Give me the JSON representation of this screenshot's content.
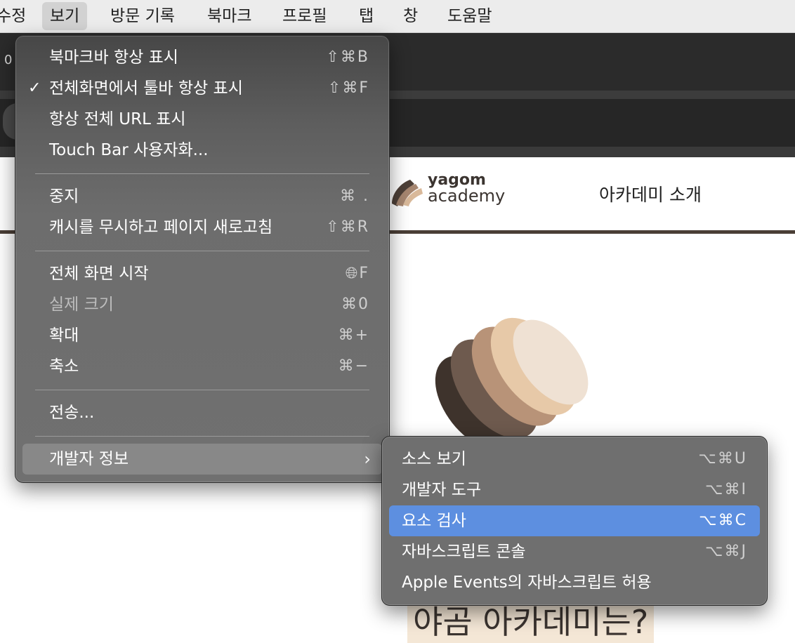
{
  "menubar": {
    "items": [
      {
        "label": "수정"
      },
      {
        "label": "보기"
      },
      {
        "label": "방문 기록"
      },
      {
        "label": "북마크"
      },
      {
        "label": "프로필"
      },
      {
        "label": "탭"
      },
      {
        "label": "창"
      },
      {
        "label": "도움말"
      }
    ]
  },
  "browser": {
    "tab_count": "0"
  },
  "page": {
    "logo_line1": "yagom",
    "logo_line2": "academy",
    "nav_link": "아카데미 소개",
    "headline": "야곰 아카데미는?"
  },
  "view_menu": {
    "items": [
      {
        "label": "북마크바 항상 표시",
        "shortcut": "⇧⌘B",
        "checked": ""
      },
      {
        "label": "전체화면에서 툴바 항상 표시",
        "shortcut": "⇧⌘F",
        "checked": "✓"
      },
      {
        "label": "항상 전체 URL 표시",
        "shortcut": ""
      },
      {
        "label": "Touch Bar 사용자화...",
        "shortcut": ""
      },
      {
        "label": "중지",
        "shortcut": "⌘ ."
      },
      {
        "label": "캐시를 무시하고 페이지 새로고침",
        "shortcut": "⇧⌘R"
      },
      {
        "label": "전체 화면 시작",
        "shortcut": "🌐︎F"
      },
      {
        "label": "실제 크기",
        "shortcut": "⌘0",
        "disabled": true
      },
      {
        "label": "확대",
        "shortcut": "⌘+"
      },
      {
        "label": "축소",
        "shortcut": "⌘−"
      },
      {
        "label": "전송...",
        "shortcut": ""
      },
      {
        "label": "개발자 정보",
        "submenu": true
      }
    ]
  },
  "dev_menu": {
    "items": [
      {
        "label": "소스 보기",
        "shortcut": "⌥⌘U"
      },
      {
        "label": "개발자 도구",
        "shortcut": "⌥⌘I"
      },
      {
        "label": "요소 검사",
        "shortcut": "⌥⌘C",
        "highlighted": true
      },
      {
        "label": "자바스크립트 콘솔",
        "shortcut": "⌥⌘J"
      },
      {
        "label": "Apple Events의 자바스크립트 허용",
        "shortcut": ""
      }
    ]
  },
  "colors": {
    "menu_highlight": "#5d8fe0",
    "brand_dark": "#4a3e36",
    "brand_cream": "#f4e7d6"
  }
}
